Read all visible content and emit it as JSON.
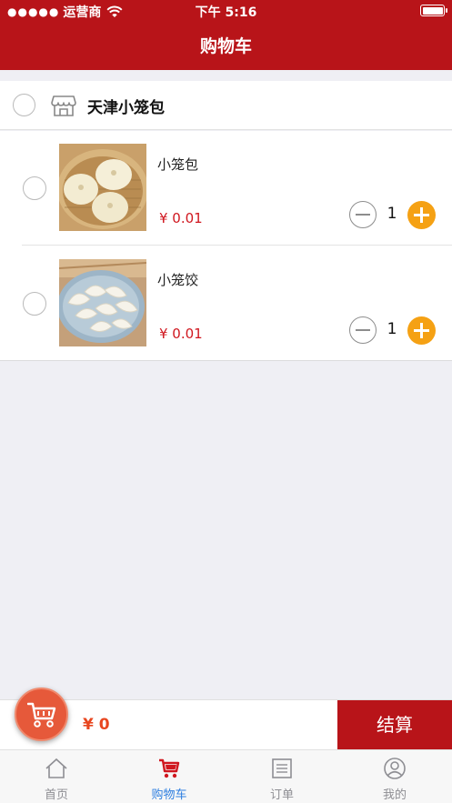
{
  "status_bar": {
    "carrier": "运营商",
    "time": "下午 5:16"
  },
  "nav": {
    "title": "购物车"
  },
  "shop": {
    "name": "天津小笼包",
    "icon": "store-icon"
  },
  "items": [
    {
      "name": "小笼包",
      "price": "¥ 0.01",
      "quantity": "1",
      "image": "steamed-buns-photo"
    },
    {
      "name": "小笼饺",
      "price": "¥ 0.01",
      "quantity": "1",
      "image": "dumplings-photo"
    }
  ],
  "checkout": {
    "total": "¥ 0",
    "button_label": "结算"
  },
  "tabs": [
    {
      "label": "首页",
      "icon": "home-icon",
      "active": false
    },
    {
      "label": "购物车",
      "icon": "cart-icon",
      "active": true
    },
    {
      "label": "订单",
      "icon": "orders-icon",
      "active": false
    },
    {
      "label": "我的",
      "icon": "profile-icon",
      "active": false
    }
  ],
  "colors": {
    "brand_red": "#b81419",
    "price_red": "#d0171f",
    "plus_orange": "#f5a114",
    "active_tab_blue": "#2f7fe0",
    "cart_fab": "#e6593a"
  }
}
